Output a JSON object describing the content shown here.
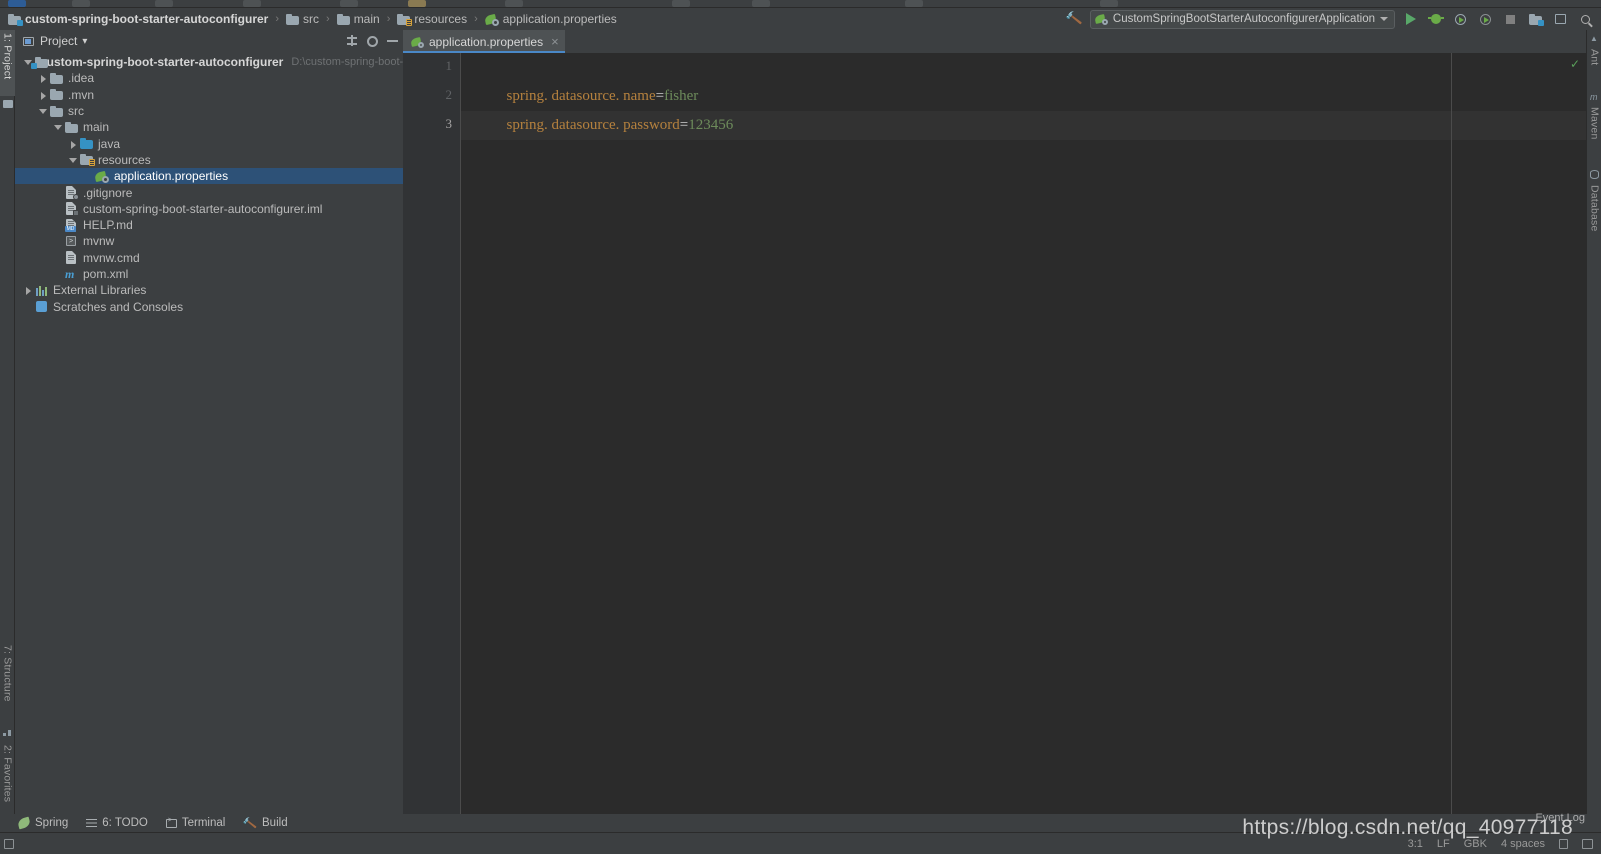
{
  "window": {
    "title": "custom-spring-boot-starter-autoconfigurer"
  },
  "breadcrumb": {
    "items": [
      {
        "label": "custom-spring-boot-starter-autoconfigurer",
        "icon": "module-folder-icon"
      },
      {
        "label": "src",
        "icon": "folder-icon"
      },
      {
        "label": "main",
        "icon": "folder-icon"
      },
      {
        "label": "resources",
        "icon": "resources-folder-icon"
      },
      {
        "label": "application.properties",
        "icon": "spring-properties-icon"
      }
    ],
    "separator": "›"
  },
  "toolbar": {
    "build_icon": "hammer-icon",
    "run_config": {
      "name": "CustomSpringBootStarterAutoconfigurerApplication",
      "icon": "spring-boot-icon"
    },
    "buttons": [
      {
        "name": "run-button",
        "icon": "play-icon"
      },
      {
        "name": "debug-button",
        "icon": "bug-icon"
      },
      {
        "name": "run-with-coverage-button",
        "icon": "coverage-icon"
      },
      {
        "name": "profile-button",
        "icon": "profile-icon"
      },
      {
        "name": "stop-button",
        "icon": "stop-icon"
      },
      {
        "name": "project-structure-button",
        "icon": "project-structure-icon"
      },
      {
        "name": "settings-button",
        "icon": "settings-window-icon"
      },
      {
        "name": "search-everywhere-button",
        "icon": "search-icon"
      }
    ]
  },
  "left_strip": {
    "tabs": [
      {
        "label": "1: Project",
        "active": true,
        "icon": "project-icon"
      },
      {
        "label": "7: Structure",
        "active": false,
        "icon": "structure-icon"
      },
      {
        "label": "2: Favorites",
        "active": false,
        "icon": "star-icon"
      }
    ]
  },
  "right_strip": {
    "tabs": [
      {
        "label": "Ant",
        "icon": "ant-icon"
      },
      {
        "label": "Maven",
        "icon": "maven-icon"
      },
      {
        "label": "Database",
        "icon": "database-icon"
      }
    ]
  },
  "project_panel": {
    "title": "Project",
    "dropdown": "▾",
    "header_buttons": [
      {
        "name": "collapse-all-button",
        "icon": "collapse-all-icon"
      },
      {
        "name": "panel-settings-button",
        "icon": "gear-icon"
      },
      {
        "name": "hide-panel-button",
        "icon": "minimize-icon"
      }
    ],
    "tree": [
      {
        "label": "custom-spring-boot-starter-autoconfigurer",
        "path": "D:\\custom-spring-boot-star",
        "indent": 0,
        "arrow": "open",
        "icon": "module-folder-icon",
        "bold": true,
        "selected": false
      },
      {
        "label": ".idea",
        "indent": 1,
        "arrow": "closed",
        "icon": "folder-icon",
        "bold": false,
        "selected": false
      },
      {
        "label": ".mvn",
        "indent": 1,
        "arrow": "closed",
        "icon": "folder-icon",
        "bold": false,
        "selected": false
      },
      {
        "label": "src",
        "indent": 1,
        "arrow": "open",
        "icon": "folder-icon",
        "bold": false,
        "selected": false
      },
      {
        "label": "main",
        "indent": 2,
        "arrow": "open",
        "icon": "folder-icon",
        "bold": false,
        "selected": false
      },
      {
        "label": "java",
        "indent": 3,
        "arrow": "closed",
        "icon": "source-folder-icon",
        "bold": false,
        "selected": false
      },
      {
        "label": "resources",
        "indent": 3,
        "arrow": "open",
        "icon": "resources-folder-icon",
        "bold": false,
        "selected": false
      },
      {
        "label": "application.properties",
        "indent": 4,
        "arrow": "none",
        "icon": "spring-properties-icon",
        "bold": false,
        "selected": true
      },
      {
        "label": ".gitignore",
        "indent": 2,
        "arrow": "none",
        "icon": "gitignore-file-icon",
        "bold": false,
        "selected": false
      },
      {
        "label": "custom-spring-boot-starter-autoconfigurer.iml",
        "indent": 2,
        "arrow": "none",
        "icon": "iml-file-icon",
        "bold": false,
        "selected": false
      },
      {
        "label": "HELP.md",
        "indent": 2,
        "arrow": "none",
        "icon": "markdown-file-icon",
        "bold": false,
        "selected": false
      },
      {
        "label": "mvnw",
        "indent": 2,
        "arrow": "none",
        "icon": "shell-file-icon",
        "bold": false,
        "selected": false
      },
      {
        "label": "mvnw.cmd",
        "indent": 2,
        "arrow": "none",
        "icon": "cmd-file-icon",
        "bold": false,
        "selected": false
      },
      {
        "label": "pom.xml",
        "indent": 2,
        "arrow": "none",
        "icon": "maven-pom-icon",
        "bold": false,
        "selected": false
      },
      {
        "label": "External Libraries",
        "indent": 0,
        "arrow": "closed",
        "icon": "libraries-icon",
        "bold": false,
        "selected": false
      },
      {
        "label": "Scratches and Consoles",
        "indent": 0,
        "arrow": "none",
        "icon": "scratches-icon",
        "bold": false,
        "selected": false
      }
    ]
  },
  "editor": {
    "tabs": [
      {
        "label": "application.properties",
        "icon": "spring-properties-icon",
        "close": "×",
        "active": true
      }
    ],
    "inspection_status": "✓",
    "line_numbers": [
      "1",
      "2",
      "3"
    ],
    "cursor_line": 3,
    "lines": [
      {
        "key": "spring. datasource. name",
        "eq": "=",
        "value": "fisher"
      },
      {
        "key": "spring. datasource. password",
        "eq": "=",
        "value": "123456"
      },
      {
        "key": "",
        "eq": "",
        "value": ""
      }
    ]
  },
  "bottom_bar": {
    "items": [
      {
        "label": "Spring",
        "icon": "spring-leaf-icon"
      },
      {
        "label": "6: TODO",
        "icon": "todo-list-icon"
      },
      {
        "label": "Terminal",
        "icon": "terminal-icon"
      },
      {
        "label": "Build",
        "icon": "hammer-icon"
      }
    ],
    "status_right": [
      {
        "label": "3:1",
        "name": "caret-position"
      },
      {
        "label": "LF",
        "name": "line-separator"
      },
      {
        "label": "GBK",
        "name": "file-encoding"
      },
      {
        "label": "4 spaces",
        "name": "indent-setting"
      },
      {
        "label": " ",
        "name": "lock-icon"
      },
      {
        "label": " ",
        "name": "memory-indicator"
      }
    ],
    "event_log": "Event Log"
  },
  "watermark": {
    "text": "https://blog.csdn.net/qq_40977118"
  },
  "colors": {
    "accent": "#4a88c7",
    "selection": "#2d5177",
    "editor_bg": "#2b2b2b",
    "panel_bg": "#3c3f41",
    "key": "#b5813e",
    "value": "#6d8b5b",
    "green": "#59a869"
  }
}
